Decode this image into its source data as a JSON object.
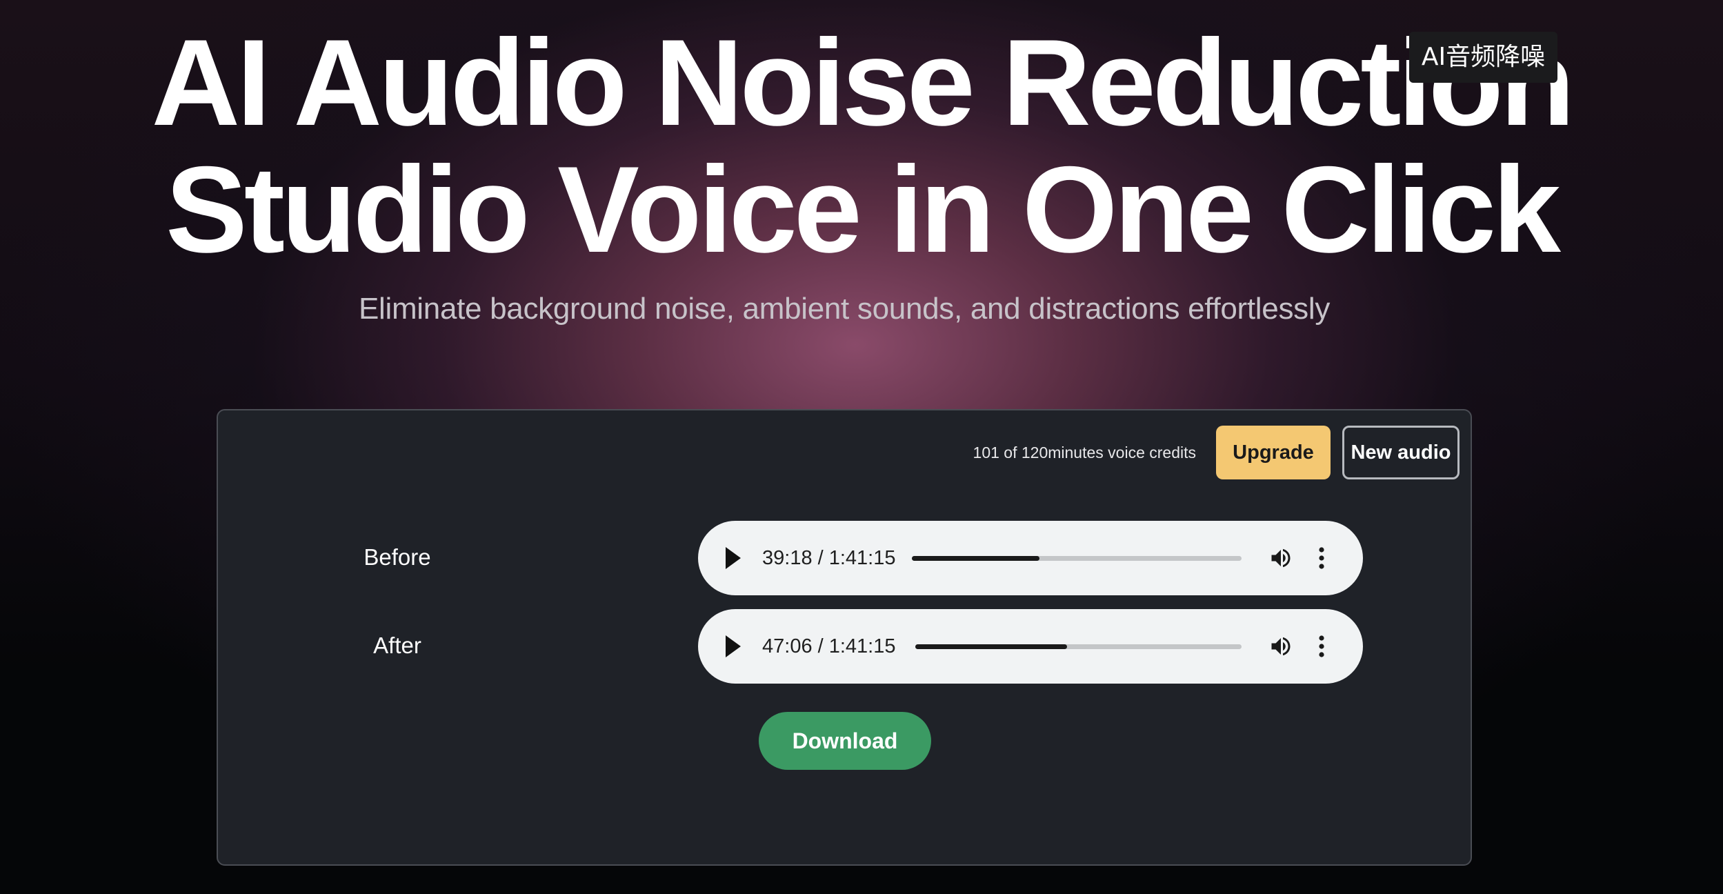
{
  "hero": {
    "title_line1": "AI Audio Noise Reduction",
    "title_line2": "Studio Voice in One Click",
    "subtitle": "Eliminate background noise, ambient sounds, and distractions effortlessly"
  },
  "tooltip": {
    "label": "AI音频降噪"
  },
  "panel": {
    "credits_text": "101 of 120minutes voice credits",
    "upgrade_label": "Upgrade",
    "new_audio_label": "New audio",
    "download_label": "Download"
  },
  "players": [
    {
      "label": "Before",
      "time": "39:18 / 1:41:15",
      "progress_fraction": 0.388
    },
    {
      "label": "After",
      "time": "47:06 / 1:41:15",
      "progress_fraction": 0.465
    }
  ],
  "icons": {
    "play": "play-icon",
    "volume": "volume-icon",
    "more": "more-vertical-icon"
  },
  "colors": {
    "upgrade": "#f4c872",
    "download": "#3b9a63",
    "panel": "#1f2228"
  }
}
